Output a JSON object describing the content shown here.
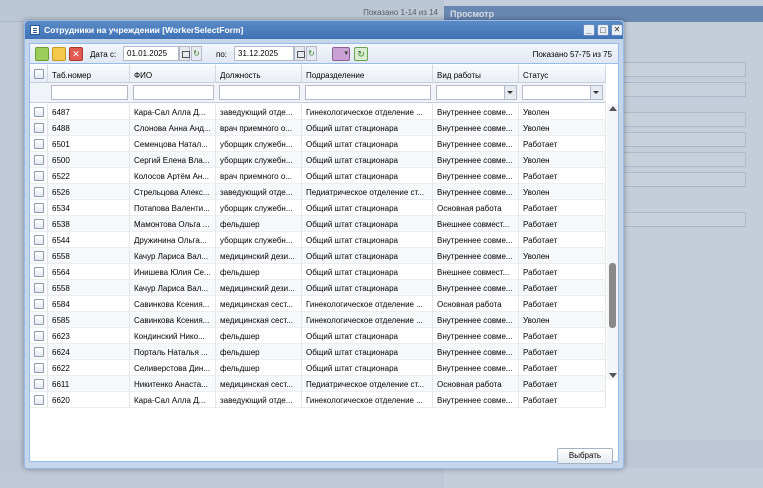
{
  "background": {
    "pagination_text": "Показано 1-14 из 14",
    "right_panel_title": "Просмотр"
  },
  "modal": {
    "title": "Сотрудники на учреждении [WorkerSelectForm]",
    "window_buttons": [
      "_",
      "□",
      "✕"
    ],
    "toolbar": {
      "date_from_label": "Дата с:",
      "date_from_value": "01.01.2025",
      "date_to_label": "по:",
      "date_to_value": "31.12.2025",
      "shown_count": "Показано 57-75 из 75",
      "delete_glyph": "✕",
      "clear_glyph": "↻",
      "refresh_glyph": "↻",
      "filter_glyph": "▾"
    },
    "grid": {
      "columns": [
        "Таб.номер",
        "ФИО",
        "Должность",
        "Подразделение",
        "Вид работы",
        "Статус"
      ],
      "rows": [
        [
          "6487",
          "Кара-Сал Алла Д...",
          "заведующий отде...",
          "Гинекологическое отделение ...",
          "Внутреннее совме...",
          "Уволен"
        ],
        [
          "6488",
          "Слонова Анна Анд...",
          "врач приемного о...",
          "Общий штат стационара",
          "Внутреннее совме...",
          "Уволен"
        ],
        [
          "6501",
          "Семенцова Натал...",
          "уборщик служебн...",
          "Общий штат стационара",
          "Внутреннее совме...",
          "Работает"
        ],
        [
          "6500",
          "Сергий Елена Вла...",
          "уборщик служебн...",
          "Общий штат стационара",
          "Внутреннее совме...",
          "Уволен"
        ],
        [
          "6522",
          "Колосов Артём Ан...",
          "врач приемного о...",
          "Общий штат стационара",
          "Внутреннее совме...",
          "Работает"
        ],
        [
          "6526",
          "Стрельцова Алекс...",
          "заведующий отде...",
          "Педиатрическое отделение ст...",
          "Внутреннее совме...",
          "Уволен"
        ],
        [
          "6534",
          "Потапова Валенти...",
          "уборщик служебн...",
          "Общий штат стационара",
          "Основная работа",
          "Работает"
        ],
        [
          "6538",
          "Мамонтова Ольга ...",
          "фельдшер",
          "Общий штат стационара",
          "Внешнее совмест...",
          "Работает"
        ],
        [
          "6544",
          "Дружинина Ольга...",
          "уборщик служебн...",
          "Общий штат стационара",
          "Внутреннее совме...",
          "Работает"
        ],
        [
          "6558",
          "Качур Лариса Вал...",
          "медицинский дези...",
          "Общий штат стационара",
          "Внутреннее совме...",
          "Уволен"
        ],
        [
          "6564",
          "Инишева Юлия Се...",
          "фельдшер",
          "Общий штат стационара",
          "Внешнее совмест...",
          "Работает"
        ],
        [
          "6558",
          "Качур Лариса Вал...",
          "медицинский дези...",
          "Общий штат стационара",
          "Внутреннее совме...",
          "Работает"
        ],
        [
          "6584",
          "Савинкова Ксения...",
          "медицинская сест...",
          "Гинекологическое отделение ...",
          "Основная работа",
          "Работает"
        ],
        [
          "6585",
          "Савинкова Ксения...",
          "медицинская сест...",
          "Гинекологическое отделение ...",
          "Внутреннее совме...",
          "Уволен"
        ],
        [
          "6623",
          "Кондинский Нико...",
          "фельдшер",
          "Общий штат стационара",
          "Внутреннее совме...",
          "Работает"
        ],
        [
          "6624",
          "Порталь Наталья ...",
          "фельдшер",
          "Общий штат стационара",
          "Внутреннее совме...",
          "Работает"
        ],
        [
          "6622",
          "Селиверстова Дин...",
          "фельдшер",
          "Общий штат стационара",
          "Внутреннее совме...",
          "Работает"
        ],
        [
          "6611",
          "Никитенко Анаста...",
          "медицинская сест...",
          "Педиатрическое отделение ст...",
          "Основная работа",
          "Работает"
        ],
        [
          "6620",
          "Кара-Сал Алла Д...",
          "заведующий отде...",
          "Гинекологическое отделение ...",
          "Внутреннее совме...",
          "Работает"
        ]
      ]
    },
    "scroll_position": 0.78,
    "select_button": "Выбрать"
  }
}
